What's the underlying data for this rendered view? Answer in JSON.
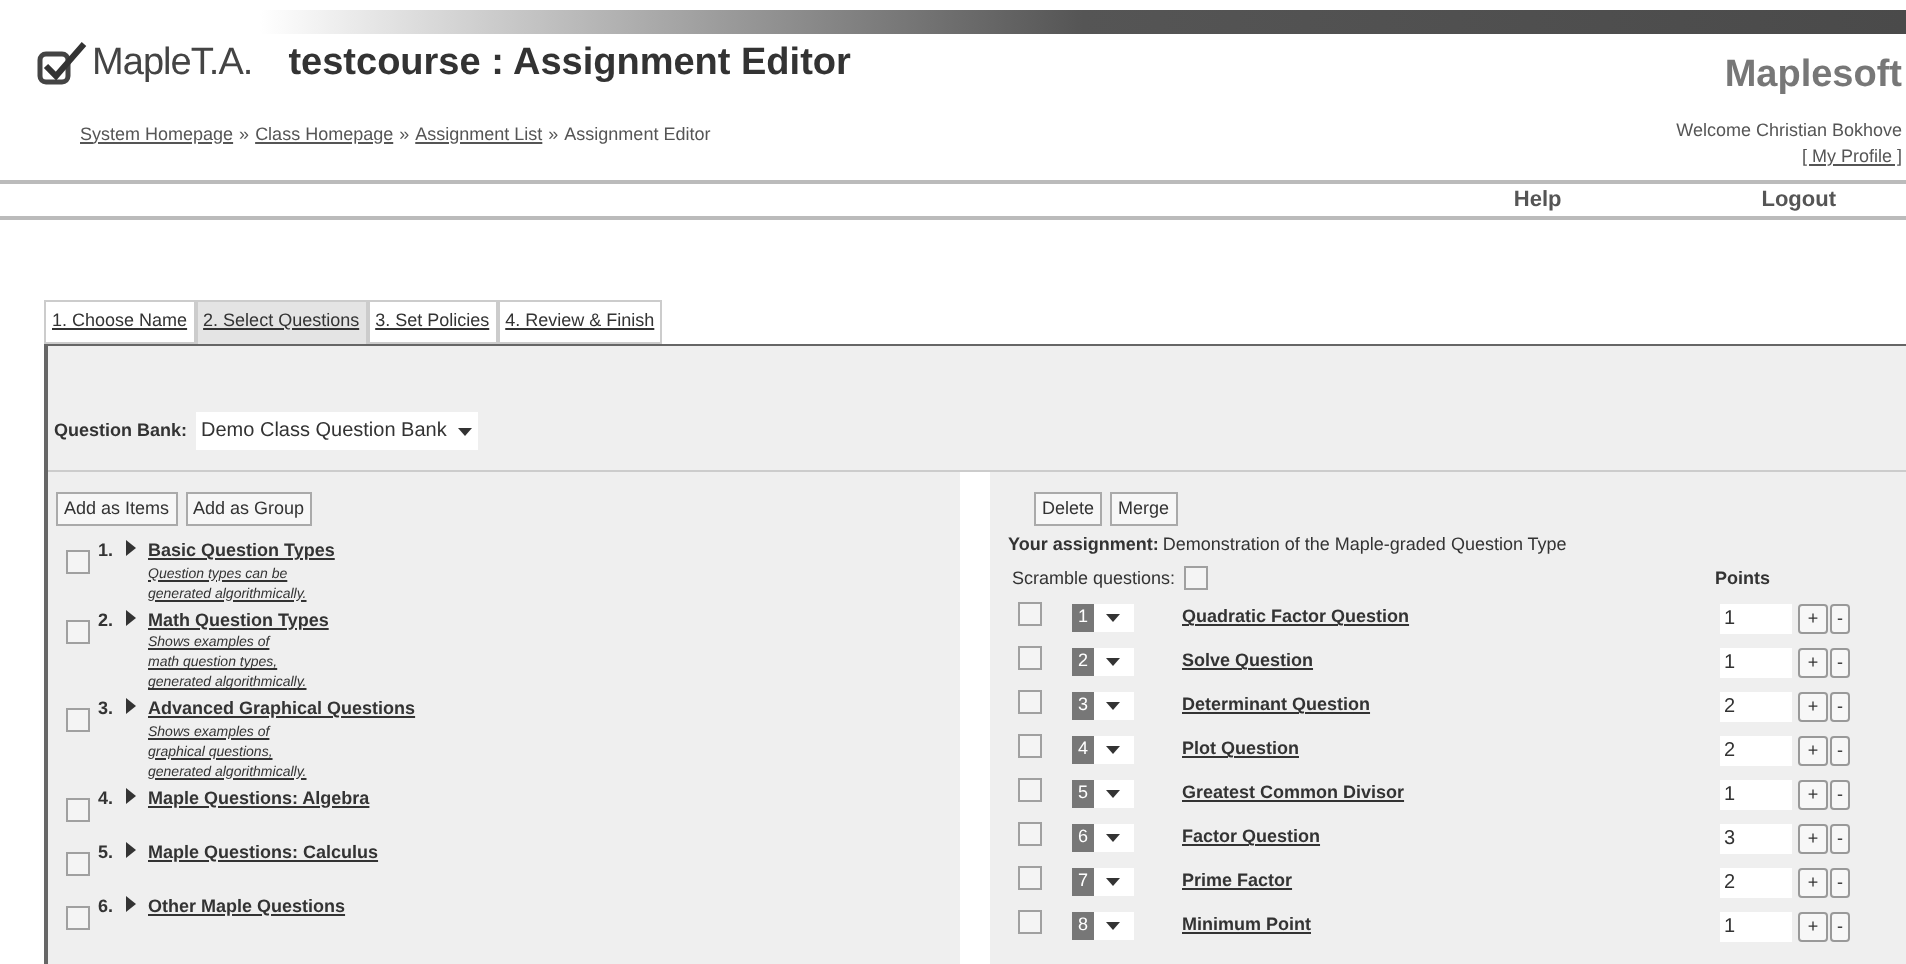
{
  "header": {
    "logo_text": "MapleT.A.",
    "title": "testcourse : Assignment Editor",
    "brand": "Maplesoft",
    "welcome": "Welcome Christian Bokhove",
    "profile_link": "[ My Profile ]"
  },
  "breadcrumb": [
    {
      "label": "System Homepage",
      "link": true
    },
    {
      "label": "»",
      "link": false
    },
    {
      "label": "Class Homepage",
      "link": true
    },
    {
      "label": "»",
      "link": false
    },
    {
      "label": "Assignment List",
      "link": true
    },
    {
      "label": "»",
      "link": false
    },
    {
      "label": "Assignment Editor",
      "link": false
    }
  ],
  "nav": [
    "Help",
    "Logout"
  ],
  "tabs": [
    {
      "label": "1. Choose Name",
      "selected": false
    },
    {
      "label": "2. Select Questions",
      "selected": true
    },
    {
      "label": "3. Set Policies",
      "selected": false
    },
    {
      "label": "4. Review & Finish",
      "selected": false
    }
  ],
  "question_bank": {
    "label": "Question Bank:",
    "value": "Demo Class Question Bank"
  },
  "left_buttons": [
    "Add as Items",
    "Add as Group"
  ],
  "groups": [
    {
      "number": "1.",
      "title": "Basic Question Types",
      "description": [
        "Question types can be",
        "generated algorithmically."
      ],
      "checked": false
    },
    {
      "number": "2.",
      "title": "Math Question Types",
      "description": [
        "Shows examples of",
        "math question types,",
        "generated algorithmically."
      ],
      "checked": false
    },
    {
      "number": "3.",
      "title": "Advanced Graphical Questions",
      "description": [
        "Shows examples of",
        "graphical questions,",
        "generated algorithmically."
      ],
      "checked": false
    },
    {
      "number": "4.",
      "title": "Maple Questions: Algebra",
      "checked": false
    },
    {
      "number": "5.",
      "title": "Maple Questions: Calculus",
      "checked": false
    },
    {
      "number": "6.",
      "title": "Other Maple Questions",
      "checked": false
    }
  ],
  "right_buttons": [
    "Delete",
    "Merge"
  ],
  "assignment": {
    "label": "Your assignment:",
    "name": "Demonstration of the Maple-graded Question Type"
  },
  "scramble": {
    "label": "Scramble questions:",
    "checked": false
  },
  "points_header": "Points",
  "plus": "+",
  "minus": "-",
  "questions": [
    {
      "order": "1",
      "title": "Quadratic Factor Question",
      "points": "1",
      "checked": false
    },
    {
      "order": "2",
      "title": "Solve Question",
      "points": "1",
      "checked": false
    },
    {
      "order": "3",
      "title": "Determinant Question",
      "points": "2",
      "checked": false
    },
    {
      "order": "4",
      "title": "Plot Question",
      "points": "2",
      "checked": false
    },
    {
      "order": "5",
      "title": "Greatest Common Divisor",
      "points": "1",
      "checked": false
    },
    {
      "order": "6",
      "title": "Factor Question",
      "points": "3",
      "checked": false
    },
    {
      "order": "7",
      "title": "Prime Factor",
      "points": "2",
      "checked": false
    },
    {
      "order": "8",
      "title": "Minimum Point",
      "points": "1",
      "checked": false
    }
  ]
}
